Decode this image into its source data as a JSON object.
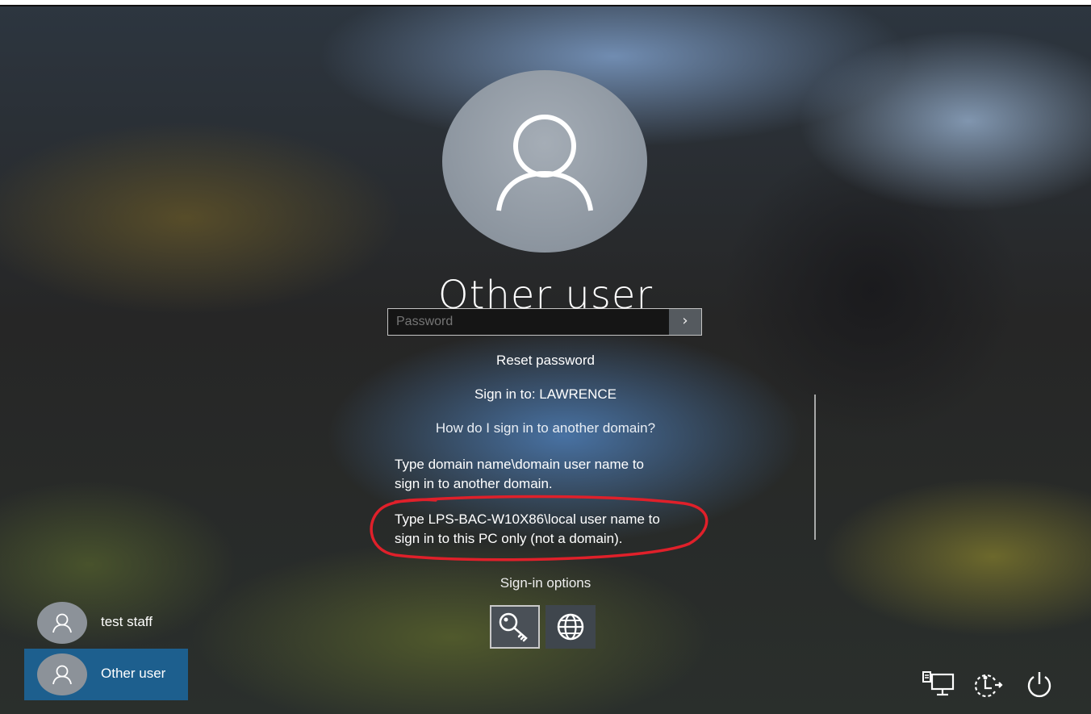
{
  "screen": {
    "title": "Other user"
  },
  "password": {
    "placeholder": "Password",
    "submit_icon": "arrow-right-icon"
  },
  "links": {
    "reset_password": "Reset password",
    "sign_in_to": "Sign in to: LAWRENCE",
    "how_other_domain": "How do I sign in to another domain?"
  },
  "help": {
    "domain_lines": [
      "Type domain name\\domain user name to",
      "sign in to another domain."
    ],
    "local_lines": [
      "Type LPS-BAC-W10X86\\local user name to",
      "sign in to this PC only (not a domain)."
    ]
  },
  "sign_in_options": {
    "label": "Sign-in options",
    "items": [
      {
        "icon": "key-icon",
        "selected": true
      },
      {
        "icon": "globe-icon",
        "selected": false
      }
    ]
  },
  "users": [
    {
      "name": "test staff",
      "selected": false
    },
    {
      "name": "Other user",
      "selected": true
    }
  ],
  "system_icons": [
    "network-icon",
    "ease-of-access-icon",
    "power-icon"
  ],
  "colors": {
    "selected_tile": "#1d5f8e",
    "annotation": "#e0202a"
  }
}
